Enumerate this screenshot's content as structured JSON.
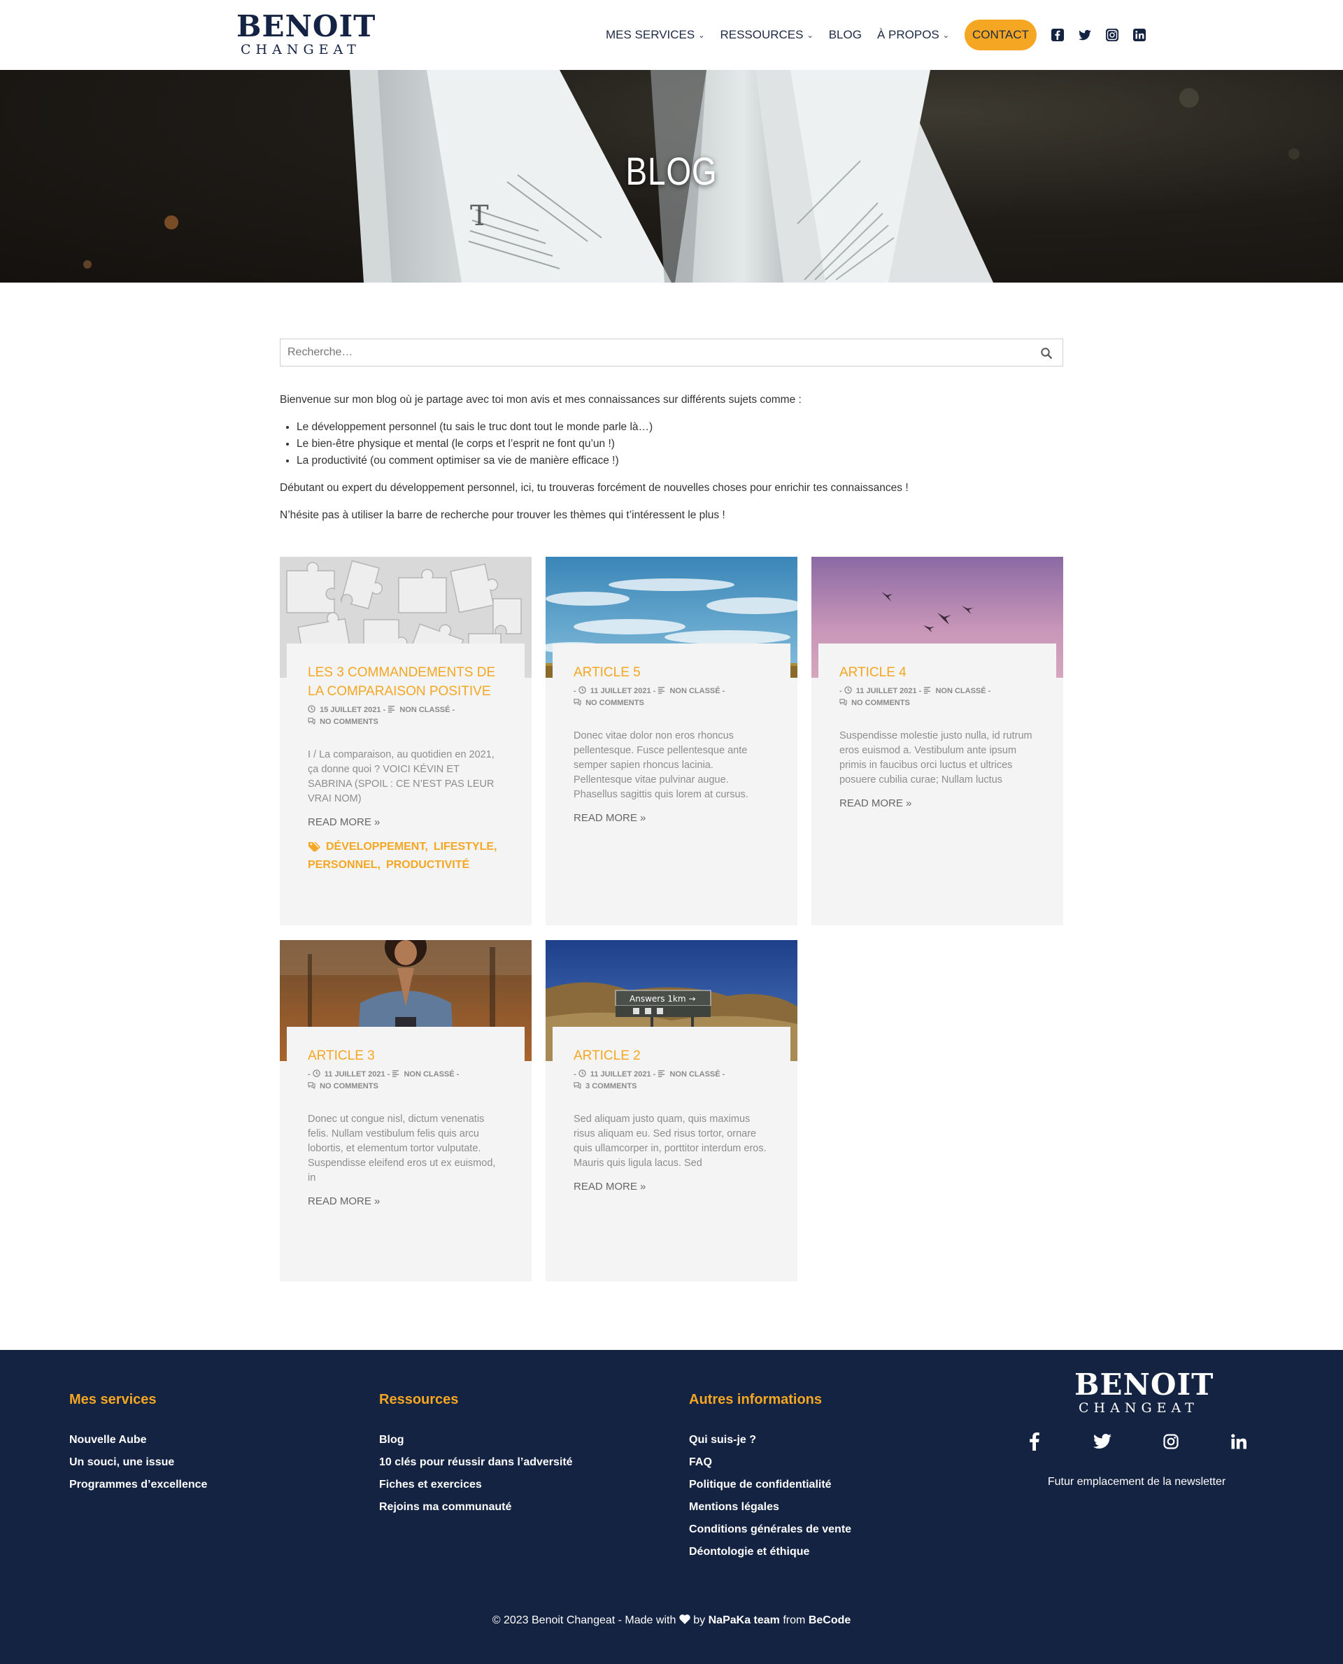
{
  "brand": {
    "line1": "BENOIT",
    "line2": "CHANGEAT",
    "accent": "#f5a623",
    "navy": "#142341"
  },
  "nav": {
    "items": [
      {
        "label": "MES SERVICES",
        "has_dropdown": true
      },
      {
        "label": "RESSOURCES",
        "has_dropdown": true
      },
      {
        "label": "BLOG",
        "has_dropdown": false
      },
      {
        "label": "À PROPOS",
        "has_dropdown": true
      }
    ],
    "contact": "CONTACT",
    "social": [
      "facebook-icon",
      "twitter-icon",
      "instagram-icon",
      "linkedin-icon"
    ]
  },
  "hero": {
    "title": "BLOG"
  },
  "search": {
    "placeholder": "Recherche…"
  },
  "intro": {
    "lead": "Bienvenue sur mon blog où je partage avec toi mon avis et mes connaissances sur différents sujets comme :",
    "bullets": [
      "Le développement personnel (tu sais le truc dont tout le monde parle là…)",
      "Le bien-être physique et mental (le corps et l’esprit ne font qu’un !)",
      "La productivité (ou comment optimiser sa vie de manière efficace !)"
    ],
    "para2": "Débutant ou expert du développement personnel, ici, tu trouveras forcément de nouvelles choses pour enrichir tes connaissances !",
    "para3": "N’hésite pas à utiliser la barre de recherche pour trouver les thèmes qui t’intéressent le plus !"
  },
  "posts": [
    {
      "title": "LES 3 COMMANDEMENTS DE LA COMPARAISON POSITIVE",
      "date": "15 JUILLET 2021",
      "category": "NON CLASSÉ",
      "comments": "NO COMMENTS",
      "excerpt": "I / La comparaison, au quotidien en 2021, ça donne quoi ? VOICI KÉVIN ET SABRINA (SPOIL : CE N’EST PAS LEUR VRAI NOM)",
      "more": "READ MORE »",
      "tags": [
        "DÉVELOPPEMENT,",
        "LIFESTYLE,",
        "PERSONNEL,",
        "PRODUCTIVITÉ"
      ],
      "image": "puzzle-pieces"
    },
    {
      "title": "ARTICLE 5",
      "date": "11 JUILLET 2021",
      "category": "NON CLASSÉ",
      "comments": "NO COMMENTS",
      "excerpt": "Donec vitae dolor non eros rhoncus pellentesque. Fusce pellentesque ante semper sapien rhoncus lacinia. Pellentesque vitae pulvinar augue. Phasellus sagittis quis lorem at cursus.",
      "more": "READ MORE »",
      "image": "blue-sky-clouds"
    },
    {
      "title": "ARTICLE 4",
      "date": "11 JUILLET 2021",
      "category": "NON CLASSÉ",
      "comments": "NO COMMENTS",
      "excerpt": "Suspendisse molestie justo nulla, id rutrum eros euismod a. Vestibulum ante ipsum primis in faucibus orci luctus et ultrices posuere cubilia curae; Nullam luctus",
      "more": "READ MORE »",
      "image": "birds-pink-sky"
    },
    {
      "title": "ARTICLE 3",
      "date": "11 JUILLET 2021",
      "category": "NON CLASSÉ",
      "comments": "NO COMMENTS",
      "excerpt": "Donec ut congue nisl, dictum venenatis felis. Nullam vestibulum felis quis arcu lobortis, et elementum tortor vulputate. Suspendisse eleifend eros ut ex euismod, in",
      "more": "READ MORE »",
      "image": "woman-praying"
    },
    {
      "title": "ARTICLE 2",
      "date": "11 JUILLET 2021",
      "category": "NON CLASSÉ",
      "comments": "3 COMMENTS",
      "excerpt": "Sed aliquam justo quam, quis maximus risus aliquam eu. Sed risus tortor, ornare quis ullamcorper in, porttitor interdum eros. Mauris quis ligula lacus. Sed",
      "more": "READ MORE »",
      "image": "answers-sign",
      "sign_text": "Answers 1km →"
    }
  ],
  "footer": {
    "col1": {
      "title": "Mes services",
      "links": [
        "Nouvelle Aube",
        "Un souci, une issue",
        "Programmes d’excellence"
      ]
    },
    "col2": {
      "title": "Ressources",
      "links": [
        "Blog",
        "10 clés pour réussir dans l’adversité",
        "Fiches et exercices",
        "Rejoins ma communauté"
      ]
    },
    "col3": {
      "title": "Autres informations",
      "links": [
        "Qui suis-je ?",
        "FAQ",
        "Politique de confidentialité",
        "Mentions légales",
        "Conditions générales de vente",
        "Déontologie et éthique"
      ]
    },
    "social": [
      "facebook-icon",
      "twitter-icon",
      "instagram-icon",
      "linkedin-icon"
    ],
    "newsletter": "Futur emplacement de la newsletter",
    "copyright": {
      "prefix": "© 2023 Benoit Changeat - Made with",
      "by": "by",
      "team": "NaPaKa team",
      "from": "from",
      "org": "BeCode"
    }
  }
}
